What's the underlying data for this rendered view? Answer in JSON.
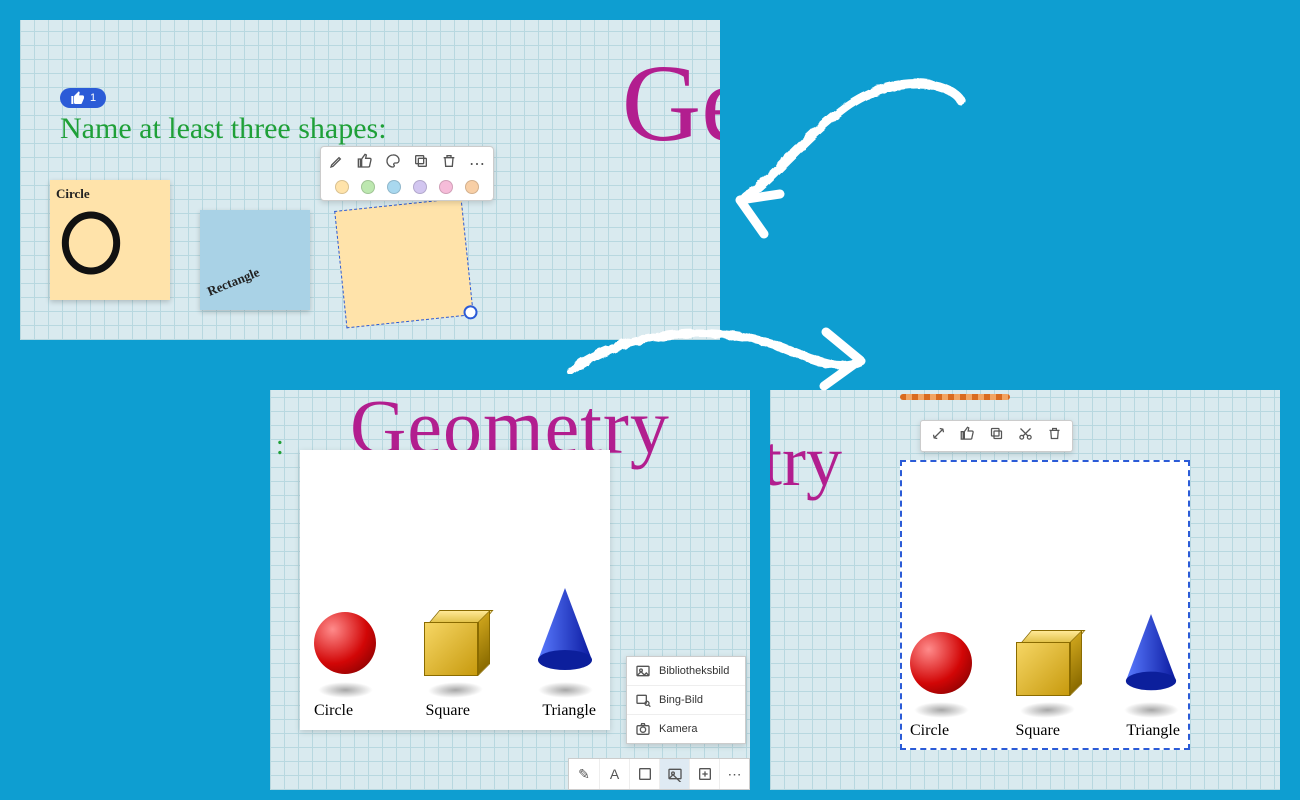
{
  "panel1": {
    "like_count": "1",
    "instruction": "Name at least three shapes:",
    "hero_partial": "Ge",
    "notes": {
      "circle_label": "Circle",
      "rectangle_label": "Rectangle"
    },
    "note_toolbar": {
      "swatches": [
        "#ffe3aa",
        "#bde8b0",
        "#a9d8ef",
        "#d2c6f0",
        "#f6bcd9",
        "#f8cfa6"
      ]
    }
  },
  "panel2": {
    "hero": "Geometry",
    "colon_fragment": ":",
    "shapes": {
      "circle": "Circle",
      "square": "Square",
      "triangle": "Triangle"
    },
    "image_menu": {
      "library": "Bibliotheksbild",
      "bing": "Bing-Bild",
      "camera": "Kamera"
    },
    "toolbar": {
      "pen": "✎",
      "text": "A",
      "note": "▭",
      "image": "▣",
      "add": "＋",
      "more": "⋯"
    }
  },
  "panel3": {
    "hero_fragment": "try",
    "shapes": {
      "circle": "Circle",
      "square": "Square",
      "triangle": "Triangle"
    }
  }
}
